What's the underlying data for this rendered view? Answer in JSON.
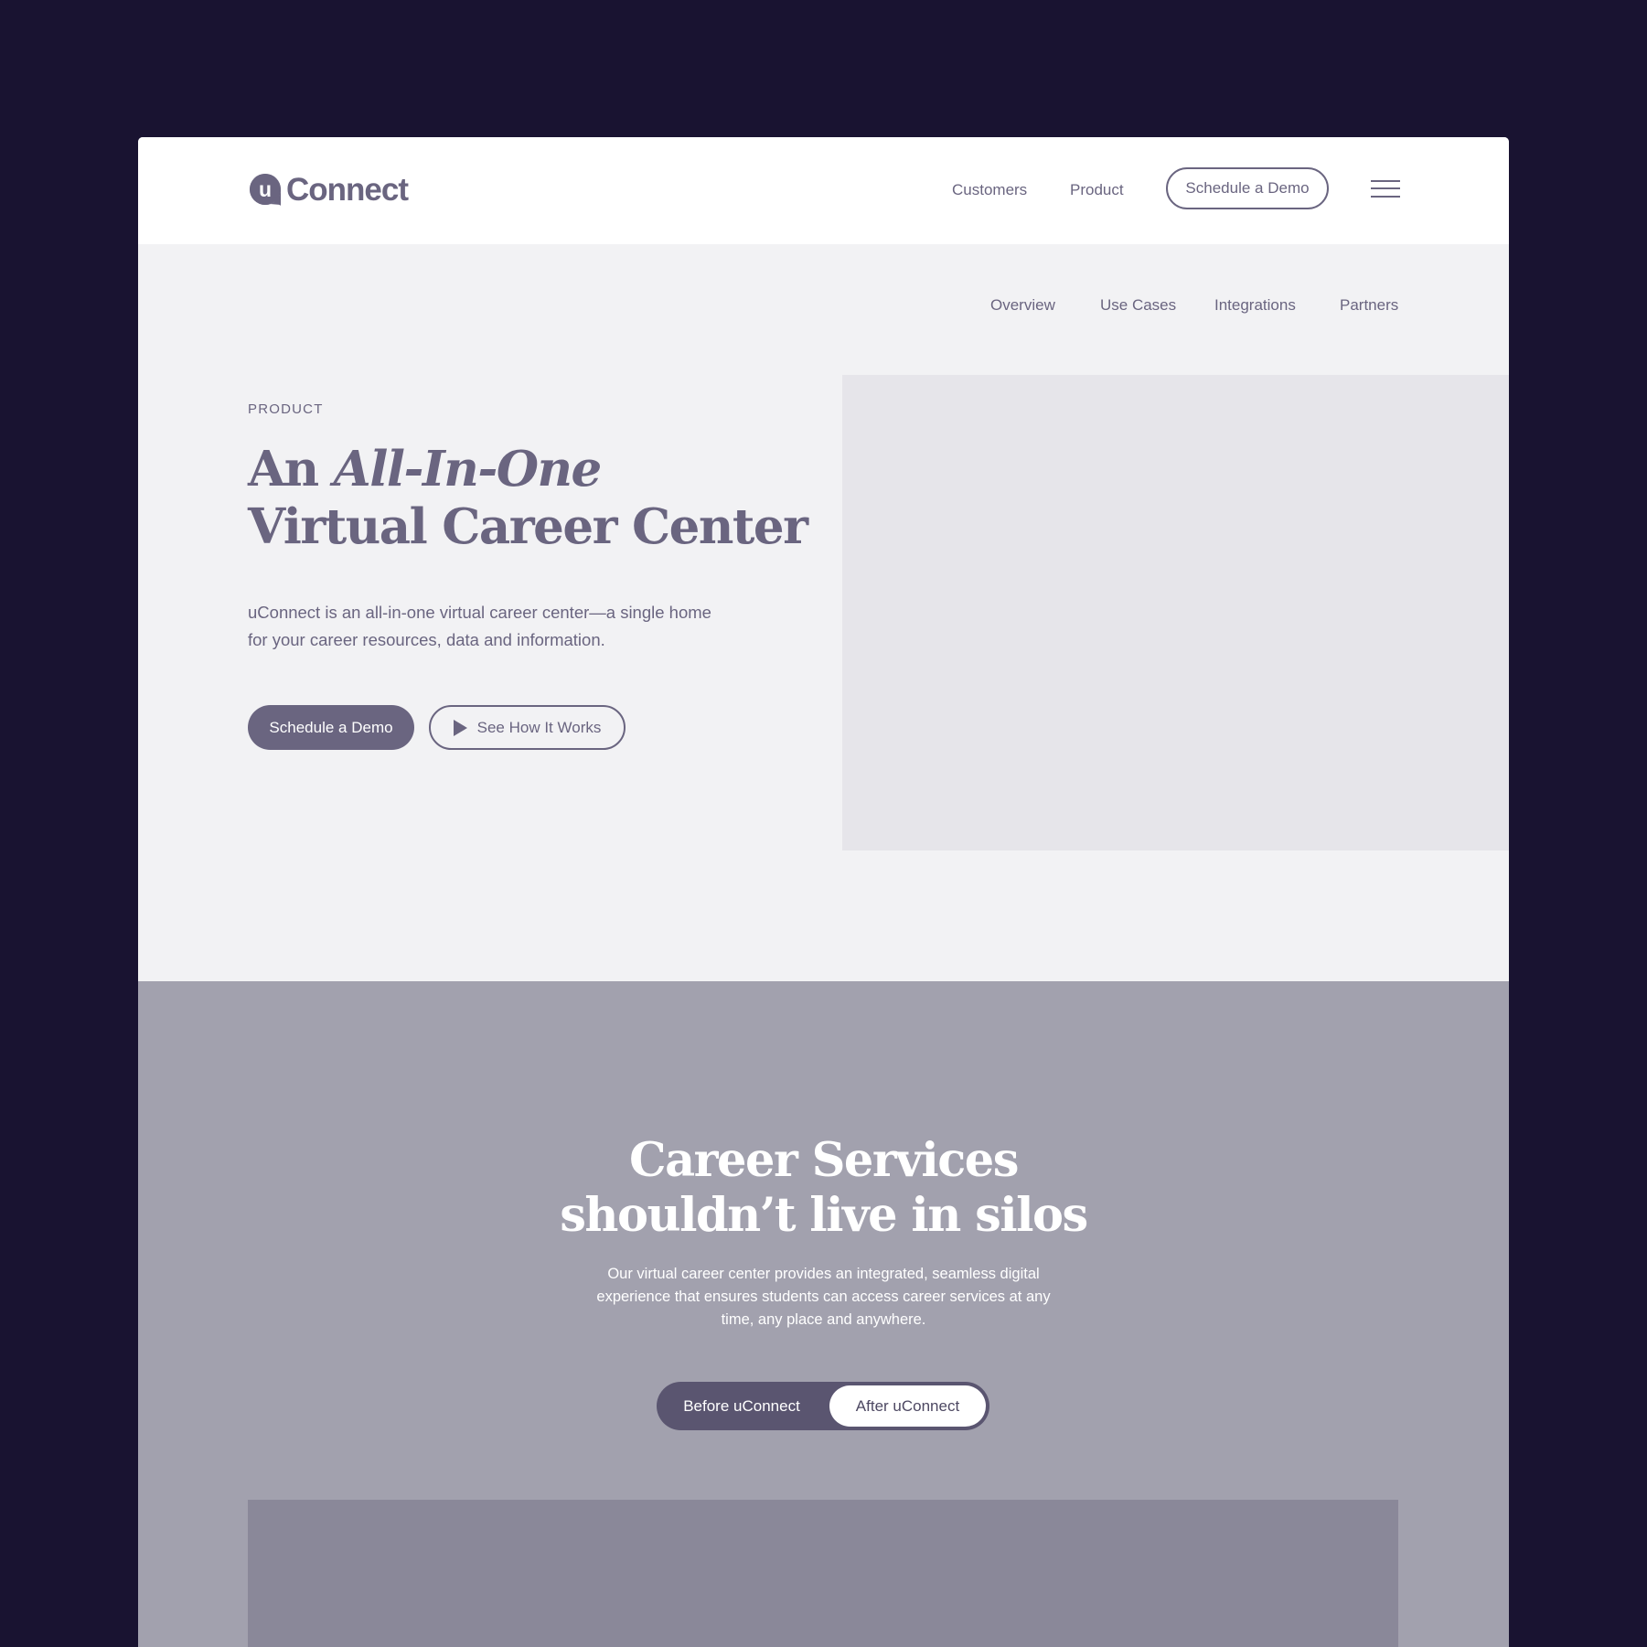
{
  "brand": {
    "logo_mark": "u",
    "logo_text": "Connect"
  },
  "top_nav": {
    "customers": "Customers",
    "product": "Product",
    "demo_button": "Schedule a Demo"
  },
  "sub_nav": {
    "overview": "Overview",
    "use_cases": "Use Cases",
    "integrations": "Integrations",
    "partners": "Partners"
  },
  "hero": {
    "eyebrow": "PRODUCT",
    "title_prefix": "An ",
    "title_emphasis": "All-In-One",
    "title_line2": "Virtual Career Center",
    "description": "uConnect is an all-in-one virtual career center—a single home for your career resources, data and information.",
    "primary_button": "Schedule a Demo",
    "secondary_button": "See How It Works"
  },
  "silos": {
    "title_line1": "Career Services",
    "title_line2": "shouldn’t live in silos",
    "description": "Our virtual career center provides an integrated, seamless digital experience that ensures students can access career services at any time, any place and anywhere.",
    "toggle_before": "Before uConnect",
    "toggle_after": "After uConnect",
    "selected": "After uConnect"
  },
  "colors": {
    "outer_background": "#191331",
    "header_background": "#ffffff",
    "hero_background": "#f2f2f4",
    "text_primary": "#6a6580",
    "media_placeholder": "#e6e5ea",
    "silos_background": "#a2a1ae",
    "toggle_background": "#5a5570",
    "silos_media_placeholder": "#8a8899"
  },
  "icons": {
    "menu": "hamburger-menu-icon",
    "play": "play-icon",
    "logo": "speech-bubble-logo-icon"
  }
}
